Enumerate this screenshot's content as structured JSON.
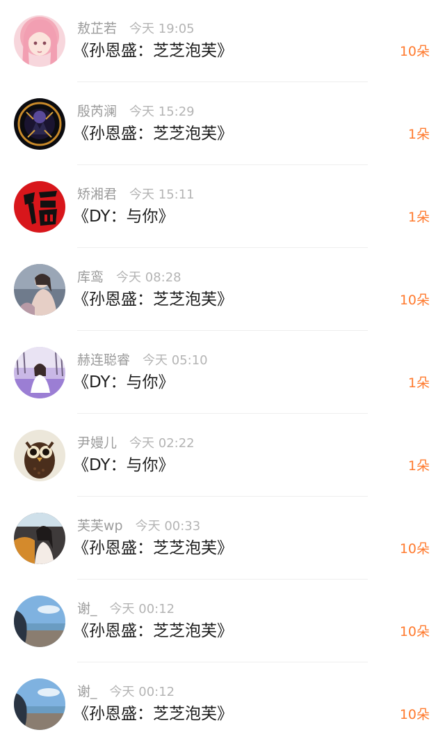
{
  "gift_unit": "朵",
  "messages": [
    {
      "name": "敖芷若",
      "time": "今天 19:05",
      "text": "《孙恩盛：芝芝泡芙》",
      "gift": "10朵",
      "avatar_icon": "anime-pink-hair-avatar-icon"
    },
    {
      "name": "殷芮澜",
      "time": "今天 15:29",
      "text": "《孙恩盛：芝芝泡芙》",
      "gift": "1朵",
      "avatar_icon": "dark-fantasy-avatar-icon"
    },
    {
      "name": "矫湘君",
      "time": "今天 15:11",
      "text": "《DY：与你》",
      "gift": "1朵",
      "avatar_icon": "fu-character-avatar-icon"
    },
    {
      "name": "库鸾",
      "time": "今天 08:28",
      "text": "《孙恩盛：芝芝泡芙》",
      "gift": "10朵",
      "avatar_icon": "girl-photo-avatar-icon"
    },
    {
      "name": "赫连聪睿",
      "time": "今天 05:10",
      "text": "《DY：与你》",
      "gift": "1朵",
      "avatar_icon": "lavender-field-avatar-icon"
    },
    {
      "name": "尹嫚儿",
      "time": "今天 02:22",
      "text": "《DY：与你》",
      "gift": "1朵",
      "avatar_icon": "owl-coffee-avatar-icon"
    },
    {
      "name": "芙芙wp",
      "time": "今天 00:33",
      "text": "《孙恩盛：芝芝泡芙》",
      "gift": "10朵",
      "avatar_icon": "girl-car-avatar-icon"
    },
    {
      "name": "谢_",
      "time": "今天 00:12",
      "text": "《孙恩盛：芝芝泡芙》",
      "gift": "10朵",
      "avatar_icon": "beach-sky-avatar-icon"
    },
    {
      "name": "谢_",
      "time": "今天 00:12",
      "text": "《孙恩盛：芝芝泡芙》",
      "gift": "10朵",
      "avatar_icon": "beach-sky-avatar-icon"
    }
  ],
  "colors": {
    "name": "#9b9b9b",
    "time": "#b4b4b4",
    "message": "#1d1d1d",
    "gift": "#ff7a2e",
    "divider": "#eeeeee"
  }
}
